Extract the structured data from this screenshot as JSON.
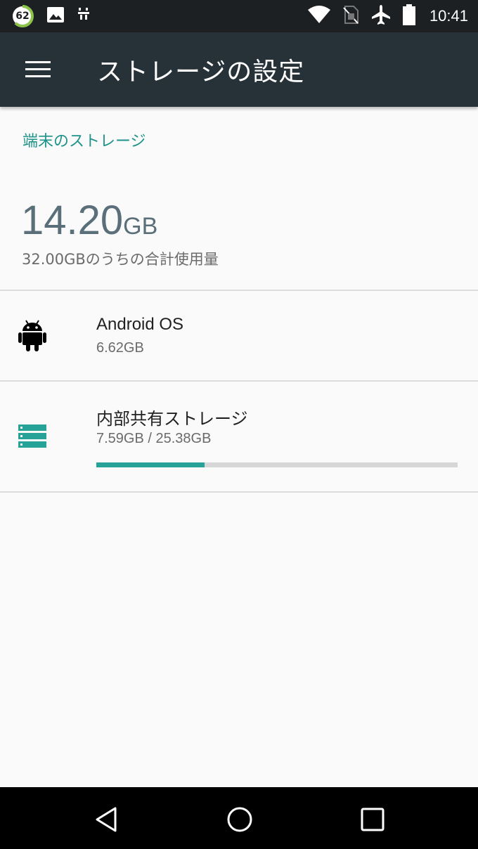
{
  "status_bar": {
    "battery_badge": "62",
    "time": "10:41",
    "icons": [
      "battery-ring-icon",
      "image-notification-icon",
      "usb-debug-icon",
      "wifi-icon",
      "no-sim-icon",
      "airplane-mode-icon",
      "battery-icon"
    ]
  },
  "app_bar": {
    "title": "ストレージの設定",
    "menu_icon": "hamburger-menu-icon"
  },
  "device_storage": {
    "section_title": "端末のストレージ",
    "used_value": "14.20",
    "used_unit": "GB",
    "description": "32.00GBのうちの合計使用量"
  },
  "items": [
    {
      "icon": "android-icon",
      "title": "Android OS",
      "subtitle": "6.62GB"
    },
    {
      "icon": "storage-icon",
      "title": "内部共有ストレージ",
      "subtitle": "7.59GB / 25.38GB",
      "usage_fraction": 0.299
    }
  ],
  "nav_bar": {
    "buttons": [
      "back-icon",
      "home-icon",
      "recents-icon"
    ]
  },
  "colors": {
    "accent": "#1e9389",
    "app_bar": "#263238",
    "status_bar": "#1c2023",
    "progress": "#27a298"
  }
}
